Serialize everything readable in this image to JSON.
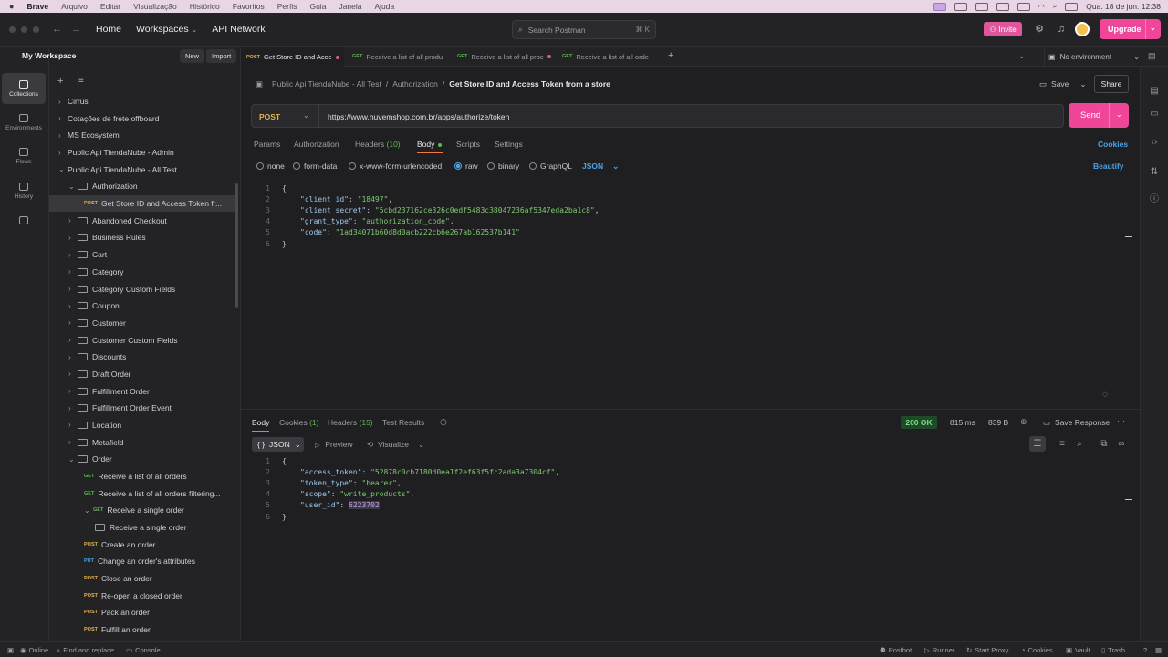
{
  "menubar": {
    "items": [
      "Brave",
      "Arquivo",
      "Editar",
      "Visualização",
      "Histórico",
      "Favoritos",
      "Perfis",
      "Guia",
      "Janela",
      "Ajuda"
    ],
    "clock": "Qua. 18 de jun.  12:38"
  },
  "topbar": {
    "home": "Home",
    "workspaces": "Workspaces",
    "api_network": "API Network",
    "search_placeholder": "Search Postman",
    "search_shortcut": "⌘  K",
    "invite": "Invite",
    "upgrade": "Upgrade"
  },
  "rail": {
    "items": [
      {
        "label": "Collections",
        "icon": "collections-icon"
      },
      {
        "label": "Environments",
        "icon": "environments-icon"
      },
      {
        "label": "Flows",
        "icon": "flows-icon"
      },
      {
        "label": "History",
        "icon": "history-icon"
      }
    ]
  },
  "sidebar": {
    "title": "My Workspace",
    "new_label": "New",
    "import_label": "Import",
    "tree": [
      {
        "label": "Cirrus",
        "indent": 0,
        "arrow": "›"
      },
      {
        "label": "Cotações de frete offboard",
        "indent": 0,
        "arrow": "›"
      },
      {
        "label": "MS Ecosystem",
        "indent": 0,
        "arrow": "›"
      },
      {
        "label": "Public Api TiendaNube - Admin",
        "indent": 0,
        "arrow": "›"
      },
      {
        "label": "Public Api TiendaNube - All Test",
        "indent": 0,
        "arrow": "⌄"
      },
      {
        "label": "Authorization",
        "indent": 1,
        "arrow": "⌄",
        "folder": true
      },
      {
        "label": "Get Store ID and Access Token fr...",
        "indent": 2,
        "method": "POST",
        "selected": true
      },
      {
        "label": "Abandoned Checkout",
        "indent": 1,
        "arrow": "›",
        "folder": true
      },
      {
        "label": "Business Rules",
        "indent": 1,
        "arrow": "›",
        "folder": true
      },
      {
        "label": "Cart",
        "indent": 1,
        "arrow": "›",
        "folder": true
      },
      {
        "label": "Category",
        "indent": 1,
        "arrow": "›",
        "folder": true
      },
      {
        "label": "Category Custom Fields",
        "indent": 1,
        "arrow": "›",
        "folder": true
      },
      {
        "label": "Coupon",
        "indent": 1,
        "arrow": "›",
        "folder": true
      },
      {
        "label": "Customer",
        "indent": 1,
        "arrow": "›",
        "folder": true
      },
      {
        "label": "Customer Custom Fields",
        "indent": 1,
        "arrow": "›",
        "folder": true
      },
      {
        "label": "Discounts",
        "indent": 1,
        "arrow": "›",
        "folder": true
      },
      {
        "label": "Draft Order",
        "indent": 1,
        "arrow": "›",
        "folder": true
      },
      {
        "label": "Fulfillment Order",
        "indent": 1,
        "arrow": "›",
        "folder": true
      },
      {
        "label": "Fulfillment Order Event",
        "indent": 1,
        "arrow": "›",
        "folder": true
      },
      {
        "label": "Location",
        "indent": 1,
        "arrow": "›",
        "folder": true
      },
      {
        "label": "Metafield",
        "indent": 1,
        "arrow": "›",
        "folder": true
      },
      {
        "label": "Order",
        "indent": 1,
        "arrow": "⌄",
        "folder": true
      },
      {
        "label": "Receive a list of all orders",
        "indent": 2,
        "method": "GET"
      },
      {
        "label": "Receive a list of all orders filtering...",
        "indent": 2,
        "method": "GET"
      },
      {
        "label": "Receive a single order",
        "indent": 2,
        "method": "GET",
        "arrow": "⌄"
      },
      {
        "label": "Receive a single order",
        "indent": 3,
        "example": true
      },
      {
        "label": "Create an order",
        "indent": 2,
        "method": "POST"
      },
      {
        "label": "Change an order's attributes",
        "indent": 2,
        "method": "PUT"
      },
      {
        "label": "Close an order",
        "indent": 2,
        "method": "POST"
      },
      {
        "label": "Re-open a closed order",
        "indent": 2,
        "method": "POST"
      },
      {
        "label": "Pack an order",
        "indent": 2,
        "method": "POST"
      },
      {
        "label": "Fulfill an order",
        "indent": 2,
        "method": "POST"
      }
    ]
  },
  "tabs": [
    {
      "method": "POST",
      "label": "Get Store ID and Acce",
      "active": true,
      "dirty": true
    },
    {
      "method": "GET",
      "label": "Receive a list of all produ",
      "active": false,
      "dirty": false
    },
    {
      "method": "GET",
      "label": "Receive a list of all proc",
      "active": false,
      "dirty": true
    },
    {
      "method": "GET",
      "label": "Receive a list of all orde",
      "active": false,
      "dirty": false
    }
  ],
  "environment": "No environment",
  "breadcrumb": {
    "collection": "Public Api TiendaNube - All Test",
    "folder": "Authorization",
    "request": "Get Store ID and Access Token from a store"
  },
  "save_label": "Save",
  "share_label": "Share",
  "request": {
    "method": "POST",
    "url": "https://www.nuvemshop.com.br/apps/authorize/token",
    "send_label": "Send",
    "tabs": {
      "params": "Params",
      "authorization": "Authorization",
      "headers": "Headers",
      "headers_count": "(10)",
      "body": "Body",
      "scripts": "Scripts",
      "settings": "Settings"
    },
    "cookies_link": "Cookies",
    "body_modes": [
      "none",
      "form-data",
      "x-www-form-urlencoded",
      "raw",
      "binary",
      "GraphQL"
    ],
    "selected_mode": "raw",
    "language": "JSON",
    "beautify": "Beautify",
    "body_lines": [
      {
        "n": "1",
        "t": "{"
      },
      {
        "n": "2",
        "key": "\"client_id\"",
        "val": "\"18497\"",
        "comma": ","
      },
      {
        "n": "3",
        "key": "\"client_secret\"",
        "val": "\"5cbd237162ce326c0edf5483c38047236af5347eda2ba1c8\"",
        "comma": ","
      },
      {
        "n": "4",
        "key": "\"grant_type\"",
        "val": "\"authorization_code\"",
        "comma": ","
      },
      {
        "n": "5",
        "key": "\"code\"",
        "val": "\"1ad34071b60d8d0acb222cb6e267ab162537b141\"",
        "comma": ""
      },
      {
        "n": "6",
        "t": "}"
      }
    ]
  },
  "response": {
    "tabs": {
      "body": "Body",
      "cookies": "Cookies",
      "cookies_count": "(1)",
      "headers": "Headers",
      "headers_count": "(15)",
      "test_results": "Test Results"
    },
    "status": "200 OK",
    "time": "815 ms",
    "size": "839 B",
    "save_response": "Save Response",
    "format": "JSON",
    "preview": "Preview",
    "visualize": "Visualize",
    "body_lines": [
      {
        "n": "1",
        "t": "{"
      },
      {
        "n": "2",
        "key": "\"access_token\"",
        "val": "\"52878c0cb7180d0ea1f2ef63f5fc2ada3a7304cf\"",
        "comma": ","
      },
      {
        "n": "3",
        "key": "\"token_type\"",
        "val": "\"bearer\"",
        "comma": ","
      },
      {
        "n": "4",
        "key": "\"scope\"",
        "val": "\"write_products\"",
        "comma": ","
      },
      {
        "n": "5",
        "key": "\"user_id\"",
        "num": "6223702",
        "comma": ""
      },
      {
        "n": "6",
        "t": "}"
      }
    ]
  },
  "statusbar": {
    "online": "Online",
    "find_replace": "Find and replace",
    "console": "Console",
    "postbot": "Postbot",
    "runner": "Runner",
    "start_proxy": "Start Proxy",
    "cookies": "Cookies",
    "vault": "Vault",
    "trash": "Trash"
  }
}
